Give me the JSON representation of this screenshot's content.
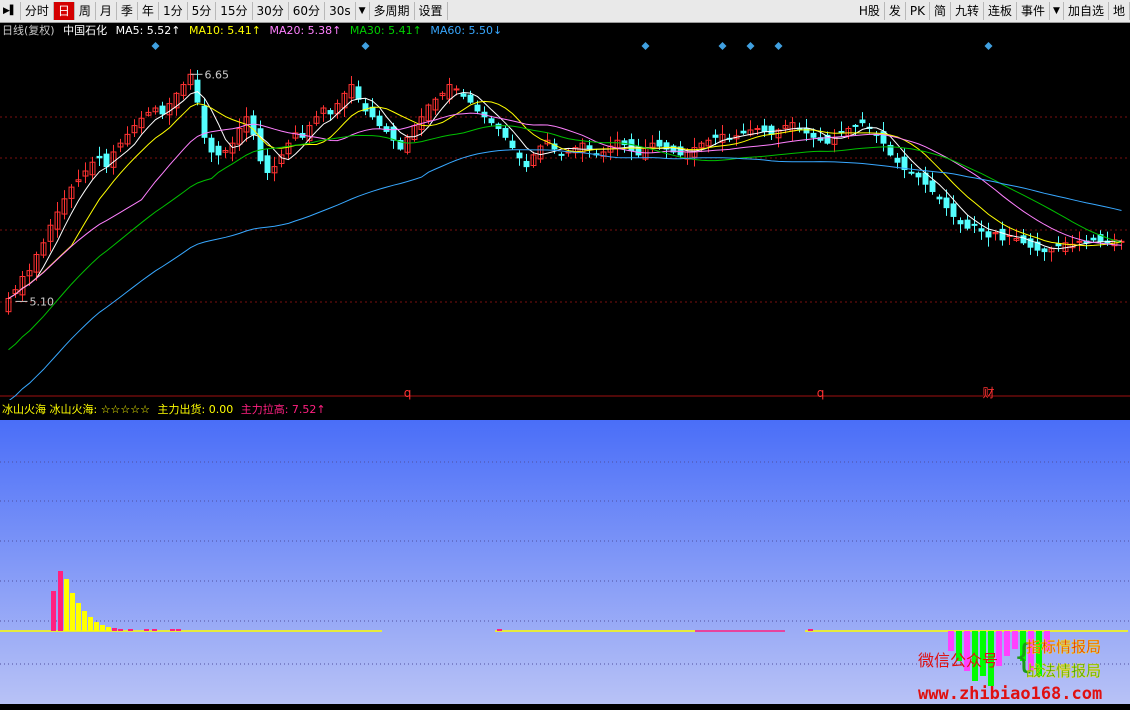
{
  "toolbar": {
    "left": [
      {
        "label": "▶▌",
        "icon": "fast-forward-icon"
      },
      {
        "label": "分时"
      },
      {
        "label": "日",
        "active": true
      },
      {
        "label": "周"
      },
      {
        "label": "月"
      },
      {
        "label": "季"
      },
      {
        "label": "年"
      },
      {
        "label": "1分"
      },
      {
        "label": "5分"
      },
      {
        "label": "15分"
      },
      {
        "label": "30分"
      },
      {
        "label": "60分"
      },
      {
        "label": "30s"
      },
      {
        "label": "▼",
        "icon": "dropdown-arrow-icon"
      },
      {
        "label": "多周期"
      },
      {
        "label": "设置"
      }
    ],
    "right": [
      {
        "label": "H股"
      },
      {
        "label": "发"
      },
      {
        "label": "PK"
      },
      {
        "label": "简"
      },
      {
        "label": "九转"
      },
      {
        "label": "连板"
      },
      {
        "label": "事件"
      },
      {
        "label": "▼",
        "icon": "dropdown-arrow-icon"
      },
      {
        "label": "加自选"
      },
      {
        "label": "地"
      }
    ]
  },
  "info": {
    "period": "日线(复权)",
    "stock": "中国石化",
    "ma5": "MA5: 5.52↑",
    "ma10": "MA10: 5.41↑",
    "ma20": "MA20: 5.38↑",
    "ma30": "MA30: 5.41↑",
    "ma60": "MA60: 5.50↓"
  },
  "colors": {
    "up": "#ff3232",
    "down": "#54ffff",
    "ma5": "#ffffff",
    "ma10": "#ffff00",
    "ma20": "#ff80ff",
    "ma30": "#00c000",
    "ma60": "#38a8ff",
    "grid": "#7a1010",
    "sub_top": "#4a6ef8",
    "sub_bottom": "#b8c2f6",
    "diamond": "#40a0e0",
    "marker": "#ff3232",
    "pink": "#ff2080",
    "yellow": "#ffff00",
    "green": "#00ff00",
    "magenta": "#ff40ff"
  },
  "subchart": {
    "title": "冰山火海 冰山火海: ☆☆☆☆☆",
    "out": "主力出货: 0.00",
    "up": "主力拉高: 7.52↑"
  },
  "watermark": {
    "wechat": "微信公众号",
    "brace": "{",
    "name1": "指标情报局",
    "name2": "战法情报局",
    "url": "www.zhibiao168.com"
  },
  "chart_data": {
    "type": "candlestick",
    "ylim": [
      4.55,
      6.85
    ],
    "annotations": [
      {
        "text": "6.65",
        "index": 26
      },
      {
        "text": "5.10",
        "index": 1
      }
    ],
    "event_markers": [
      {
        "text": "q",
        "index": 57
      },
      {
        "text": "q",
        "index": 116
      },
      {
        "text": "财",
        "index": 140
      }
    ],
    "diamond_markers": [
      21,
      51,
      91,
      102,
      106,
      110,
      140
    ],
    "prices": [
      5.12,
      5.18,
      5.27,
      5.31,
      5.42,
      5.5,
      5.62,
      5.71,
      5.8,
      5.88,
      5.93,
      5.99,
      6.05,
      6.08,
      6.02,
      6.12,
      6.18,
      6.24,
      6.3,
      6.35,
      6.39,
      6.42,
      6.38,
      6.45,
      6.52,
      6.58,
      6.65,
      6.46,
      6.22,
      6.12,
      6.1,
      6.13,
      6.18,
      6.28,
      6.36,
      6.24,
      6.06,
      5.98,
      6.02,
      6.1,
      6.18,
      6.25,
      6.22,
      6.3,
      6.36,
      6.42,
      6.38,
      6.45,
      6.52,
      6.58,
      6.48,
      6.4,
      6.36,
      6.3,
      6.26,
      6.2,
      6.14,
      6.22,
      6.3,
      6.36,
      6.44,
      6.48,
      6.52,
      6.58,
      6.55,
      6.5,
      6.46,
      6.4,
      6.36,
      6.32,
      6.28,
      6.22,
      6.15,
      6.08,
      6.02,
      6.1,
      6.16,
      6.2,
      6.14,
      6.1,
      6.12,
      6.15,
      6.18,
      6.14,
      6.1,
      6.12,
      6.16,
      6.2,
      6.17,
      6.13,
      6.1,
      6.15,
      6.18,
      6.16,
      6.14,
      6.12,
      6.1,
      6.12,
      6.15,
      6.18,
      6.2,
      6.22,
      6.24,
      6.21,
      6.23,
      6.25,
      6.27,
      6.28,
      6.26,
      6.24,
      6.27,
      6.3,
      6.32,
      6.28,
      6.25,
      6.22,
      6.2,
      6.18,
      6.22,
      6.25,
      6.28,
      6.3,
      6.32,
      6.28,
      6.24,
      6.18,
      6.1,
      6.05,
      6.0,
      5.98,
      5.95,
      5.9,
      5.85,
      5.8,
      5.74,
      5.68,
      5.63,
      5.6,
      5.62,
      5.58,
      5.54,
      5.57,
      5.52,
      5.55,
      5.53,
      5.5,
      5.47,
      5.45,
      5.44,
      5.46,
      5.48,
      5.5,
      5.49,
      5.51,
      5.5,
      5.52,
      5.51,
      5.5,
      5.52,
      5.51
    ]
  }
}
